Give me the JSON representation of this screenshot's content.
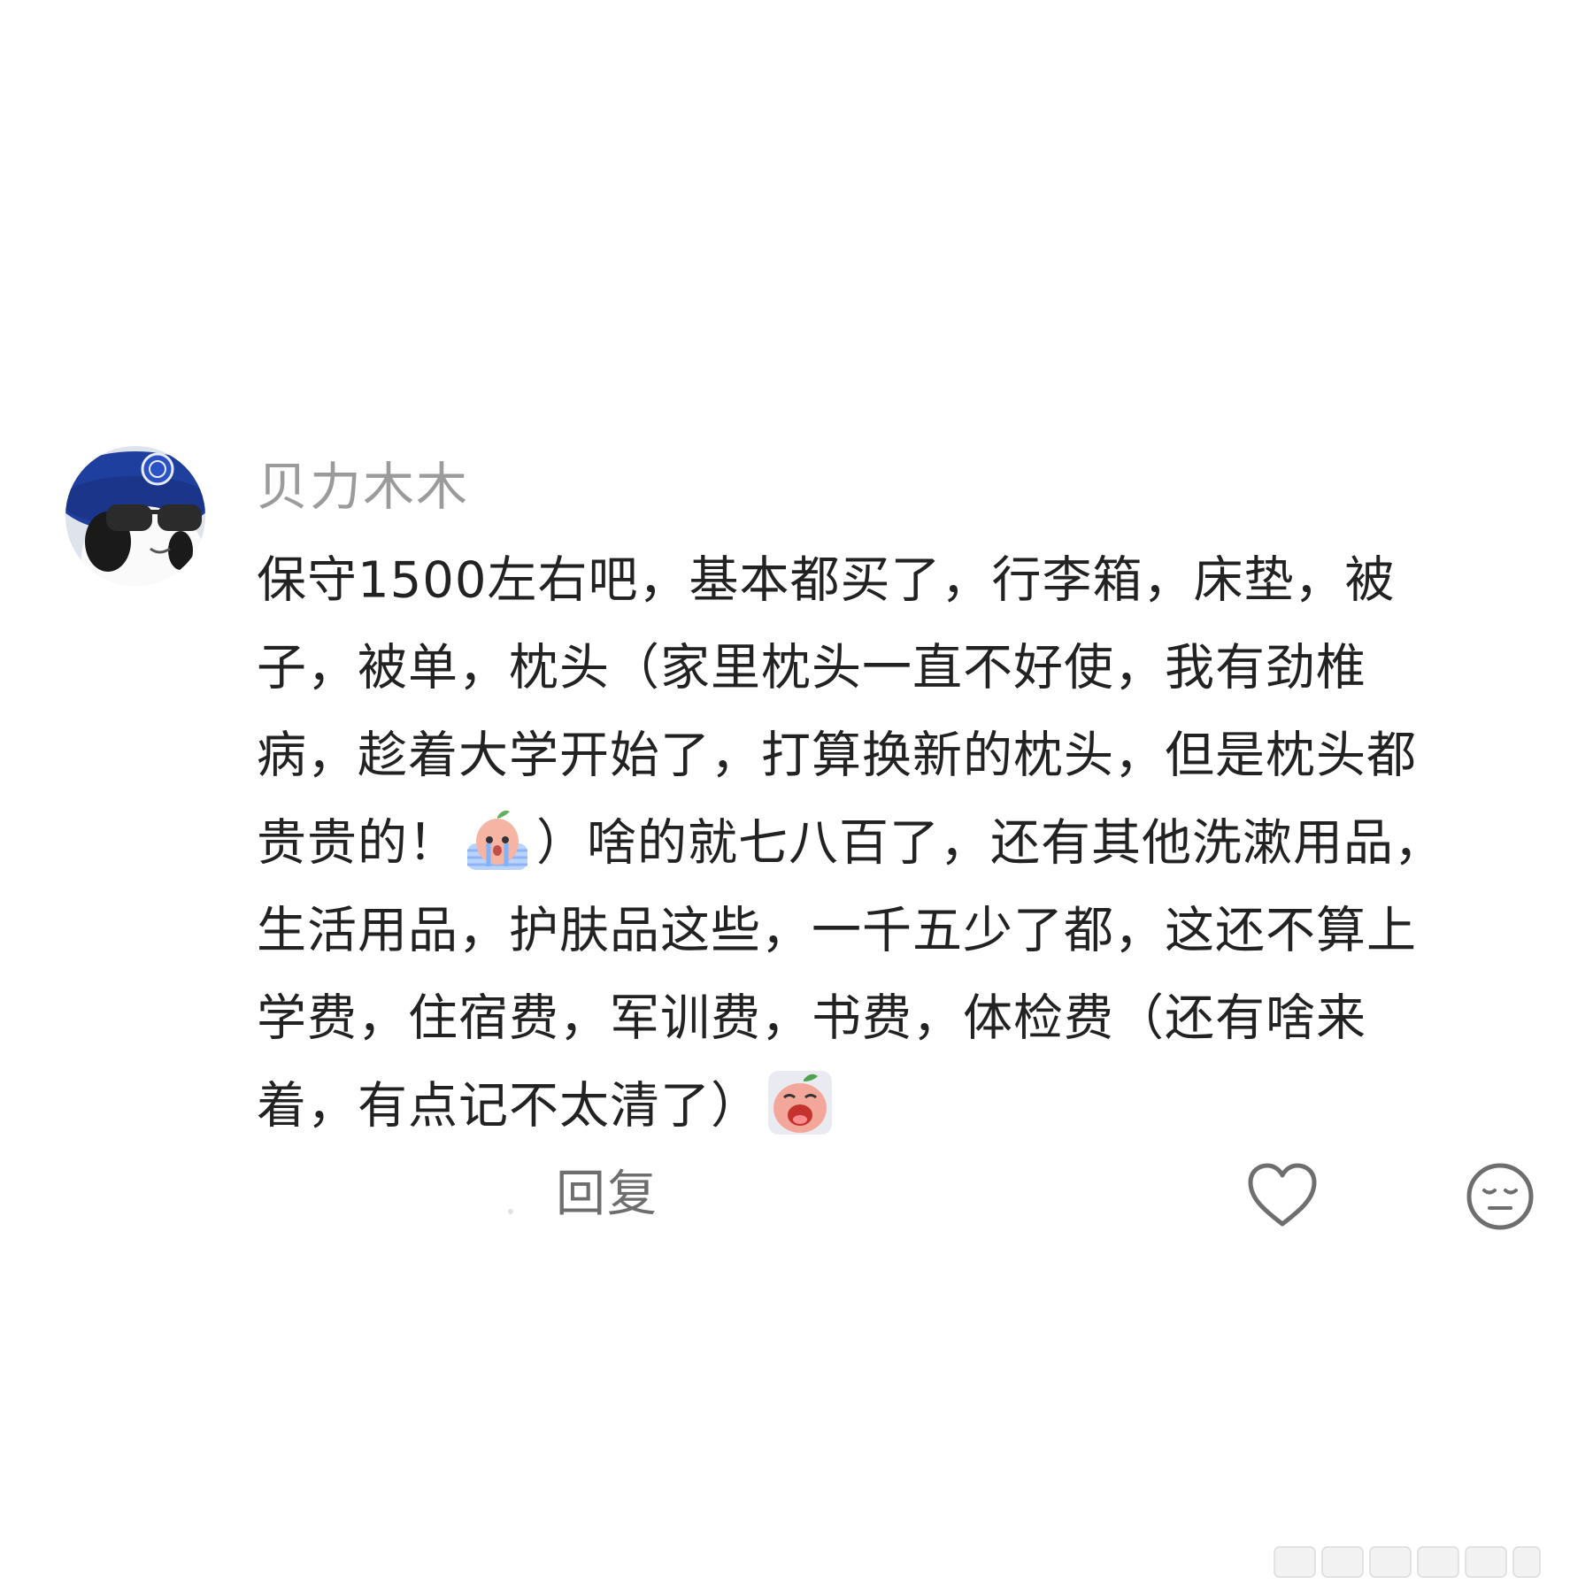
{
  "comment": {
    "username": "贝力木木",
    "body_lines": [
      [
        "保守1500左右吧，基本都买了，行李箱，床垫，被"
      ],
      [
        "子，被单，枕头（家里枕头一直不好使，我有劲椎"
      ],
      [
        "病，趁着大学开始了，打算换新的枕头，但是枕头都"
      ],
      [
        "贵贵的！",
        "）啥的就七八百了，还有其他洗漱用品，"
      ],
      [
        "生活用品，护肤品这些，一千五少了都，这还不算上"
      ],
      [
        "学费，住宿费，军训费，书费，体检费（还有啥来"
      ],
      [
        "着，有点记不太清了）"
      ]
    ],
    "emojis": [
      "crying-peach-emoji",
      "wailing-peach-emoji"
    ],
    "actions": {
      "reply_label": "回复",
      "like_icon": "heart-outline-icon",
      "dislike_icon": "meh-face-icon"
    }
  },
  "colors": {
    "username": "#9b9b9b",
    "body": "#222222",
    "actions": "#6e6e6e",
    "avatar_beret": "#1f3f9e"
  },
  "watermark_icon": "weibo-watermark-icon"
}
